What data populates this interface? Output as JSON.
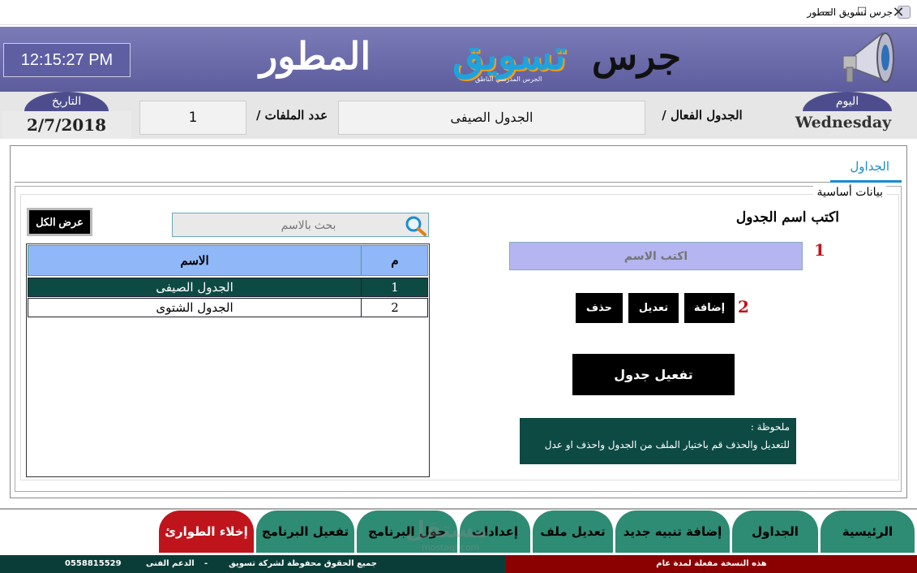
{
  "window": {
    "title": "جرس تسويق المطور"
  },
  "header": {
    "clock": "12:15:27 PM",
    "logo_p1": "جرس",
    "logo_p2": "تسويق",
    "logo_p3": "المطور",
    "logo_sub": "الجرس المدرسي الناطق",
    "date_label": "التاريخ",
    "date_value": "2/7/2018",
    "files_label": "عدد الملفات /",
    "files_value": "1",
    "active_label": "الجدول الفعال /",
    "active_value": "الجدول الصيفى",
    "day_label": "اليوم",
    "day_value": "Wednesday"
  },
  "tabs": {
    "active": "الجداول"
  },
  "form": {
    "group_title": "بيانات أساسية",
    "name_label": "اكتب اسم الجدول",
    "name_placeholder": "اكتب الاسم",
    "step1": "1",
    "step2": "2",
    "add": "إضافة",
    "edit": "تعديل",
    "delete": "حذف",
    "activate": "تفعيل جدول",
    "note_title": "ملحوظة :",
    "note_text": "للتعديل والحذف قم باختيار الملف من الجدول واحذف او عدل"
  },
  "list": {
    "show_all": "عرض الكل",
    "search_placeholder": "بحث بالاسم",
    "col_no": "م",
    "col_name": "الاسم",
    "rows": [
      {
        "no": "1",
        "name": "الجدول الصيفى"
      },
      {
        "no": "2",
        "name": "الجدول الشتوى"
      }
    ]
  },
  "nav": {
    "home": "الرئيسية",
    "tables": "الجداول",
    "add_alert": "إضافة تنبيه جديد",
    "edit_file": "تعديل ملف",
    "settings": "إعدادات",
    "about": "حول البرنامج",
    "activate_app": "تفعيل البرنامج",
    "evacuation": "إخلاء الطوارئ"
  },
  "status": {
    "license": "هذه النسخة مفعلة لمدة عام",
    "rights": "جميع الحقوق محفوظة لشركة تسويق",
    "support_label": "الدعم الفنى",
    "sep": "-",
    "phone": "0558815529"
  },
  "colors": {
    "banner": "#5d5d9e",
    "nav": "#2e8b74",
    "evacuation": "#c0141c",
    "grid_header": "#90b8f8",
    "selected_row": "#0d4a44"
  }
}
